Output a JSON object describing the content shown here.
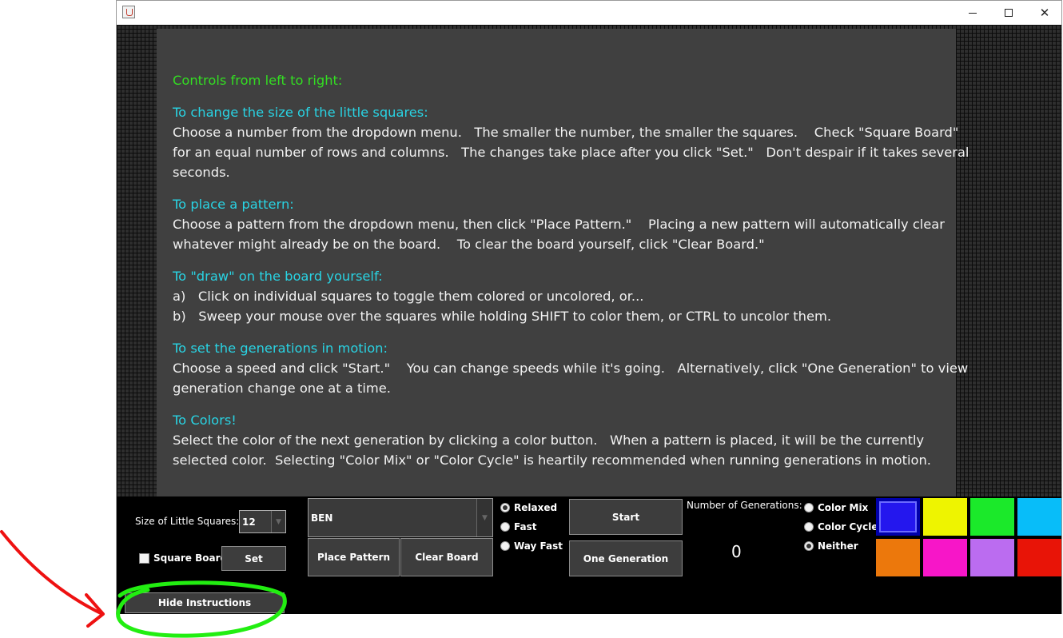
{
  "window": {
    "title": ""
  },
  "instructions": {
    "heading": "Controls from left to right:",
    "sections": [
      {
        "title": "To change the size of the little squares:",
        "lines": [
          "Choose a number from the dropdown menu.   The smaller the number, the smaller the squares.    Check \"Square Board\"",
          "for an equal number of rows and columns.   The changes take place after you click \"Set.\"   Don't despair if it takes several",
          "seconds."
        ]
      },
      {
        "title": "To place a pattern:",
        "lines": [
          "Choose a pattern from the dropdown menu, then click \"Place Pattern.\"    Placing a new pattern will automatically clear",
          "whatever might already be on the board.    To clear the board yourself, click \"Clear Board.\""
        ]
      },
      {
        "title": "To \"draw\" on the board yourself:",
        "lines": [
          "a)   Click on individual squares to toggle them colored or uncolored, or...",
          "b)   Sweep your mouse over the squares while holding SHIFT to color them, or CTRL to uncolor them."
        ]
      },
      {
        "title": "To set the generations in motion:",
        "lines": [
          "Choose a speed and click \"Start.\"    You can change speeds while it's going.   Alternatively, click \"One Generation\" to view",
          "generation change one at a time."
        ]
      },
      {
        "title": "To Colors!",
        "lines": [
          "Select the color of the next generation by clicking a color button.   When a pattern is placed, it will be the currently",
          "selected color.  Selecting \"Color Mix\" or \"Color Cycle\" is heartily recommended when running generations in motion."
        ]
      }
    ]
  },
  "controls": {
    "size_label": "Size of Little Squares:",
    "size_value": "12",
    "square_board_label": "Square Board",
    "square_board_checked": false,
    "set_label": "Set",
    "hide_instructions_label": "Hide Instructions",
    "pattern_value": "BEN",
    "place_pattern_label": "Place Pattern",
    "clear_board_label": "Clear Board",
    "speeds": [
      {
        "label": "Relaxed",
        "selected": true
      },
      {
        "label": "Fast",
        "selected": false
      },
      {
        "label": "Way Fast",
        "selected": false
      }
    ],
    "start_label": "Start",
    "one_generation_label": "One Generation",
    "generations_label": "Number of Generations:",
    "generations_count": "0",
    "color_modes": [
      {
        "label": "Color Mix",
        "selected": false
      },
      {
        "label": "Color Cycle",
        "selected": false
      },
      {
        "label": "Neither",
        "selected": true
      }
    ],
    "colors": [
      {
        "name": "blue",
        "hex": "#2417ee",
        "selected": true
      },
      {
        "name": "yellow",
        "hex": "#eef400",
        "selected": false
      },
      {
        "name": "green",
        "hex": "#1be92a",
        "selected": false
      },
      {
        "name": "sky-blue",
        "hex": "#08bdf9",
        "selected": false
      },
      {
        "name": "orange",
        "hex": "#ec780c",
        "selected": false
      },
      {
        "name": "pink",
        "hex": "#f716c8",
        "selected": false
      },
      {
        "name": "lavender",
        "hex": "#bb6cf0",
        "selected": false
      },
      {
        "name": "red",
        "hex": "#e81407",
        "selected": false
      }
    ]
  },
  "annotation": {
    "arrow_color": "#ee1111",
    "circle_color": "#22ee11"
  }
}
